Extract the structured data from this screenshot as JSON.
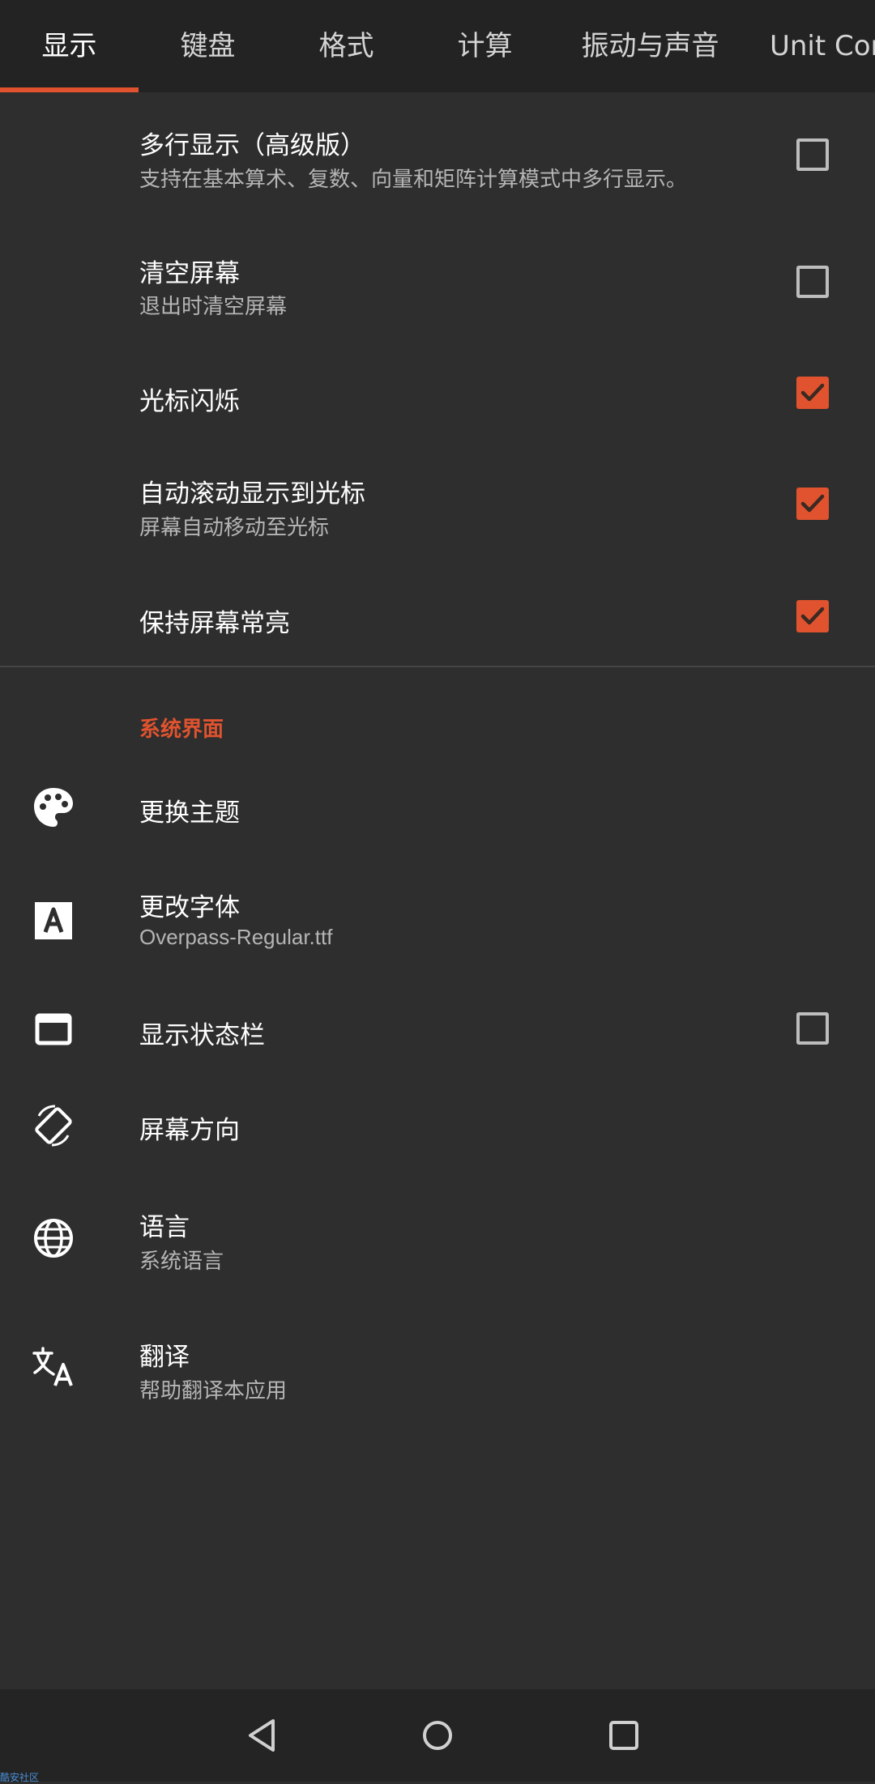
{
  "tabs": [
    {
      "label": "显示",
      "active": true
    },
    {
      "label": "键盘",
      "active": false
    },
    {
      "label": "格式",
      "active": false
    },
    {
      "label": "计算",
      "active": false
    },
    {
      "label": "振动与声音",
      "active": false
    },
    {
      "label": "Unit Con",
      "active": false
    }
  ],
  "display_settings": [
    {
      "title": "多行显示（高级版）",
      "subtitle": "支持在基本算术、复数、向量和矩阵计算模式中多行显示。",
      "checked": false
    },
    {
      "title": "清空屏幕",
      "subtitle": "退出时清空屏幕",
      "checked": false
    },
    {
      "title": "光标闪烁",
      "subtitle": "",
      "checked": true
    },
    {
      "title": "自动滚动显示到光标",
      "subtitle": "屏幕自动移动至光标",
      "checked": true
    },
    {
      "title": "保持屏幕常亮",
      "subtitle": "",
      "checked": true
    }
  ],
  "system_section": {
    "header": "系统界面",
    "items": [
      {
        "icon": "palette-icon",
        "title": "更换主题",
        "subtitle": ""
      },
      {
        "icon": "font-icon",
        "title": "更改字体",
        "subtitle": "Overpass-Regular.ttf"
      },
      {
        "icon": "window-icon",
        "title": "显示状态栏",
        "subtitle": "",
        "checked": false
      },
      {
        "icon": "screen-rotation-icon",
        "title": "屏幕方向",
        "subtitle": ""
      },
      {
        "icon": "globe-icon",
        "title": "语言",
        "subtitle": "系统语言"
      },
      {
        "icon": "translate-icon",
        "title": "翻译",
        "subtitle": "帮助翻译本应用"
      }
    ]
  },
  "navbar": {
    "back": "back-icon",
    "home": "home-icon",
    "recents": "recents-icon"
  },
  "watermark": "酷安社区",
  "colors": {
    "accent": "#e0532e",
    "background": "#2e2e2e",
    "tabbar": "#232323"
  }
}
